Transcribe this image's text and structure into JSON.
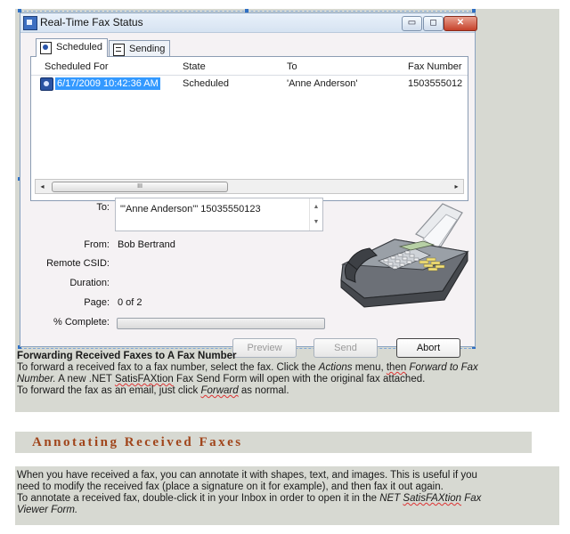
{
  "window": {
    "title": "Real-Time Fax Status",
    "controls": {
      "minimize": "▭",
      "maximize": "◻",
      "close": "✕"
    }
  },
  "tabs": [
    {
      "label": "Scheduled",
      "active": true
    },
    {
      "label": "Sending",
      "active": false
    }
  ],
  "list": {
    "columns": [
      "Scheduled For",
      "State",
      "To",
      "Fax Number"
    ],
    "rows": [
      {
        "scheduled_for": "6/17/2009 10:42:36 AM",
        "state": "Scheduled",
        "to": "'Anne Anderson'",
        "fax_number": "1503555012"
      }
    ],
    "scroll_left": "◂",
    "scroll_right": "▸",
    "scroll_grip": "III"
  },
  "details": {
    "to_label": "To:",
    "to_value": "\"'Anne Anderson'\"  15035550123",
    "from_label": "From:",
    "from_value": "Bob Bertrand",
    "csid_label": "Remote CSID:",
    "csid_value": "",
    "duration_label": "Duration:",
    "duration_value": "",
    "page_label": "Page:",
    "page_value": "0 of 2",
    "complete_label": "% Complete:",
    "progress_fraction": 0
  },
  "buttons": {
    "preview": "Preview",
    "send": "Send",
    "abort": "Abort"
  },
  "doc": {
    "section1_title": "Forwarding Received  Faxes to A Fax Number",
    "p1_a": "To forward a received fax to a fax number, select the fax. Click the ",
    "p1_actions": "Actions",
    "p1_b": " menu, ",
    "p1_then": "then",
    "p1_c": " ",
    "p1_forward_to": "Forward  to Fax",
    "p1_line2_a": "Number.",
    "p1_line2_b": "  A new .NET ",
    "p1_line2_sfx": "SatisFAXtion",
    "p1_line2_c": " Fax Send Form will open with the original fax attached.",
    "p1_line3_a": "To forward the fax as an email, just click ",
    "p1_line3_forward": "Forward",
    "p1_line3_b": "  as normal.",
    "section2_title": "Annotating Received Faxes",
    "p2_line1": "When you have received a fax, you can annotate it with shapes, text, and images. This is useful if you",
    "p2_line2": "need to modify the received fax (place a signature on it for example), and then  fax it out again.",
    "p2_line3_a": "To annotate a received fax, double-click it in your Inbox in order to open it in the ",
    "p2_line3_b": "NET ",
    "p2_line3_sfx": "SatisFAXtion",
    "p2_line3_c": " Fax",
    "p2_line4": "Viewer Form."
  }
}
